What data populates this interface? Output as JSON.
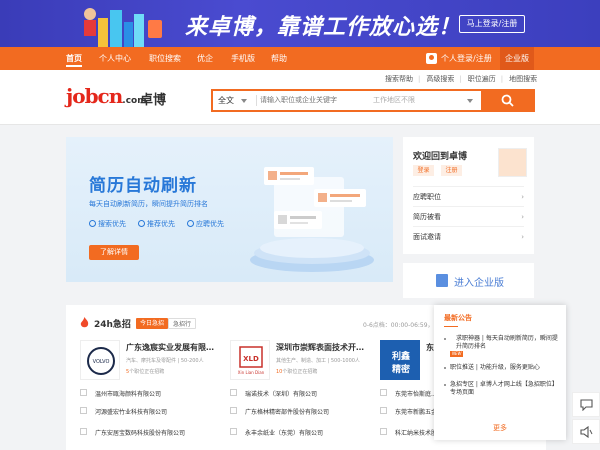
{
  "banner": {
    "slogan": "来卓博，靠谱工作放心选！",
    "login_label": "马上登录/注册"
  },
  "nav": {
    "items": [
      "首页",
      "个人中心",
      "职位搜索",
      "优企",
      "手机版",
      "帮助"
    ],
    "user_label": "个人登录/注册",
    "enterprise_label": "企业版"
  },
  "header": {
    "logo_main": "jobcn",
    "logo_suffix": ".com",
    "logo_cn": "卓博",
    "links": [
      "搜索帮助",
      "高级搜索",
      "职位遍历",
      "地图搜索"
    ],
    "search": {
      "scope": "全文",
      "keyword_placeholder": "请输入职位或企业关键字",
      "location_placeholder": "工作地区不限"
    }
  },
  "hero": {
    "title": "简历自动刷新",
    "subtitle": "每天自动刷新简历，瞬间提升简历排名",
    "features": [
      "搜索优先",
      "推荐优先",
      "应聘优先"
    ],
    "cta": "了解详情"
  },
  "welcome": {
    "title": "欢迎回到卓博",
    "login": "登录",
    "register": "注册",
    "rows": [
      "应聘职位",
      "简历被看",
      "面试邀请"
    ]
  },
  "enter_enterprise": "进入企业版",
  "jobs": {
    "title": "24h急招",
    "tag1": "今日急招",
    "tag2": "急招行",
    "note": "0-6点档：00:00-06:59，",
    "cards": [
      {
        "name": "广东逸宸实业发展有限公...",
        "sub": "汽车、摩托车及零配件 | 50-200人",
        "count": "5",
        "count_label": "个职位正在招聘",
        "logo": "VOLVO"
      },
      {
        "name": "深圳市崇辉表面技术开发...",
        "sub": "其他生产、制造、加工 | 500-1000人",
        "count": "10",
        "count_label": "个职位正在招聘",
        "logo": "Xin Lian Dian"
      },
      {
        "name": "东莞...",
        "sub": "",
        "count": "",
        "count_label": "",
        "logo": "利鑫精密"
      }
    ],
    "companies": [
      [
        "温州市瓯海颜料有限公司",
        "瑞诺技术（深圳）有限公司",
        "东莞市怡斯庭..."
      ],
      [
        "河源盛宏竹业科技有限公司",
        "广东格林精密部件股份有限公司",
        "东莞市新鹏五金..."
      ],
      [
        "广东安居宝数码科技股份有限公司",
        "永丰余纸业（东莞）有限公司",
        "科汇纳米技术股..."
      ]
    ]
  },
  "notice": {
    "title": "最新公告",
    "items": [
      {
        "text": "求职神器 | 每天自动刷新简历，瞬间提升简历排名",
        "badge": "NEW"
      },
      {
        "text": "职位推送 | 功能升级，服务更贴心",
        "badge": ""
      },
      {
        "text": "急招专区 | 卓博人才网上线【急招职位】专场页面",
        "badge": ""
      }
    ],
    "more": "更多"
  },
  "colors": {
    "brand": "#f26b21",
    "banner": "#3a3cb8",
    "hero_blue": "#2878d8"
  }
}
